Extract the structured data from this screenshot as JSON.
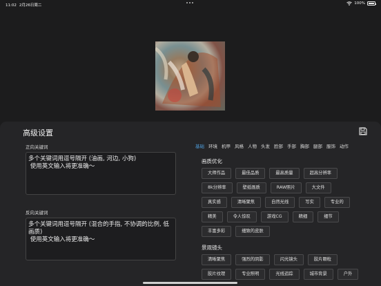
{
  "status": {
    "time": "11:02",
    "date": "2月26日周二",
    "battery": "100%",
    "battery_level": 1.0
  },
  "panel": {
    "title": "高级设置",
    "save_icon": "save-icon"
  },
  "positive": {
    "label": "正向关键词",
    "text": "多个关键词用逗号隔开 (油画, 河边, 小狗)\n 使用英文输入将更准确～"
  },
  "negative": {
    "label": "反向关键词",
    "text": "多个关键词用逗号隔开 (混合的手指, 不协调的比例, 低画质)\n 使用英文输入将更准确～"
  },
  "tabs": [
    "基础",
    "环境",
    "机甲",
    "风格",
    "人物",
    "头发",
    "脸部",
    "手部",
    "胸部",
    "腿部",
    "服饰",
    "动作"
  ],
  "active_tab_index": 0,
  "accent_color": "#4d9bd8",
  "sections": [
    {
      "title": "画质优化",
      "chips": [
        "大师作品",
        "最佳品质",
        "最高质量",
        "超高分辨率",
        "8k分辨率",
        "壁纸画质",
        "RAW照片",
        "大文件",
        "真实感",
        "清晰聚焦",
        "自然光线",
        "写实",
        "专业的",
        "精美",
        "令人惊叹",
        "游戏CG",
        "精细",
        "细节",
        "丰富多彩",
        "细致的皮肤"
      ]
    },
    {
      "title": "景观镜头",
      "chips": [
        "清晰聚焦",
        "强烈的阴影",
        "闪光镜头",
        "胶片颗粒",
        "胶片纹理",
        "专业照明",
        "光线追踪",
        "城市背景",
        "户外"
      ]
    }
  ]
}
